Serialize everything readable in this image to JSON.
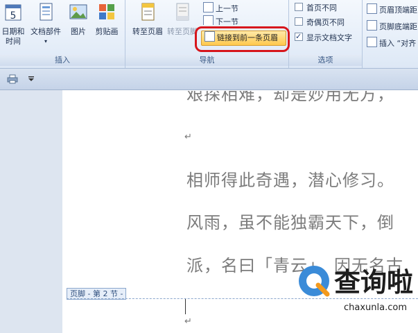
{
  "ribbon": {
    "insert_group": {
      "label": "插入",
      "buttons": [
        {
          "label_line1": "日期和",
          "label_line2": "时间",
          "icon": "calendar-icon"
        },
        {
          "label_line1": "文档部件",
          "label_line2": "▾",
          "icon": "document-parts-icon"
        },
        {
          "label_line1": "图片",
          "label_line2": "",
          "icon": "picture-icon"
        },
        {
          "label_line1": "剪贴画",
          "label_line2": "",
          "icon": "clipart-icon"
        }
      ]
    },
    "nav_group": {
      "label": "导航",
      "goto_header": "转至页眉",
      "goto_footer": "转至页脚",
      "prev_section": "上一节",
      "next_section": "下一节",
      "link_to_previous": "链接到前一条页眉"
    },
    "options_group": {
      "label": "选项",
      "checks": [
        {
          "label": "首页不同",
          "checked": false
        },
        {
          "label": "奇偶页不同",
          "checked": false
        },
        {
          "label": "显示文档文字",
          "checked": true
        }
      ]
    },
    "position_group": {
      "header_pos": "页眉顶端距",
      "footer_pos": "页脚底端距",
      "insert_align": "插入 “对齐"
    }
  },
  "document": {
    "lines": [
      "艰探相难，却是妙用无方，",
      "相师得此奇遇，潜心修习。",
      "风雨，虽不能独霸天下，倒",
      "派，名曰「青云」。因无名古"
    ],
    "paragraph_mark": "↵",
    "footer_tag": "页脚 - 第 2 节 -"
  },
  "watermark": {
    "text": "查询啦",
    "url": "chaxunla.com"
  },
  "colors": {
    "highlight_border": "#d7161c",
    "active_button": "#ffc94e"
  }
}
